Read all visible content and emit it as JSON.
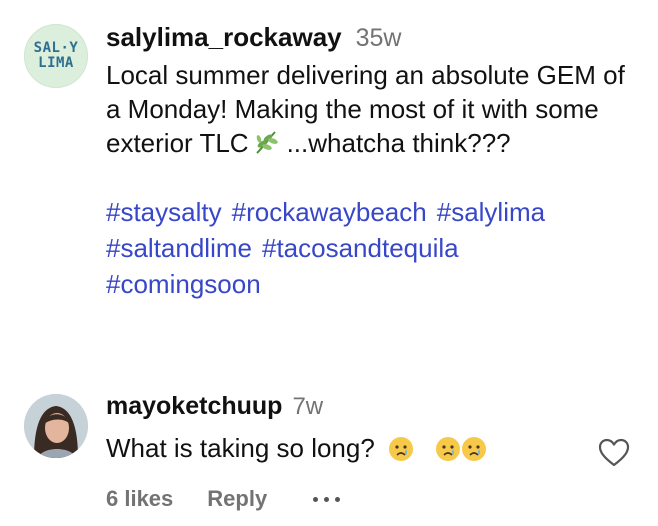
{
  "post": {
    "avatar": {
      "logo_line1": "SAL·Y",
      "logo_line2": "LIMA"
    },
    "username": "salylima_rockaway",
    "time": "35w",
    "caption_before_icon": "Local summer delivering an absolute GEM of a Monday! Making the most of it with some exterior TLC",
    "caption_icon": "herb-icon",
    "caption_after_icon": "...whatcha think???",
    "hashtags": [
      [
        "#staysalty",
        "#rockawaybeach",
        "#salylima"
      ],
      [
        "#saltandlime",
        "#tacosandtequila"
      ],
      [
        "#comingsoon"
      ]
    ]
  },
  "comment": {
    "username": "mayoketchuup",
    "time": "7w",
    "text": "What is taking so long?",
    "emojis": [
      "crying-face-icon",
      "crying-face-icon",
      "crying-face-icon"
    ],
    "likes": "6 likes",
    "reply_label": "Reply",
    "more_icon": "more-dots-icon",
    "like_icon": "heart-outline-icon"
  },
  "colors": {
    "hashtag": "#3847c9",
    "secondary_text": "#737373",
    "logo_text": "#2e6f8f",
    "logo_bg": "#dcefdc"
  }
}
